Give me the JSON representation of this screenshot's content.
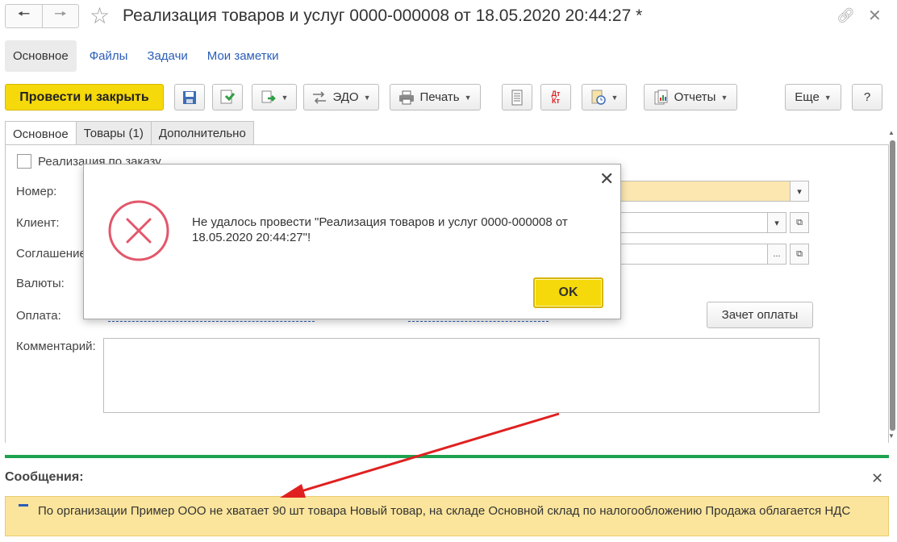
{
  "window": {
    "title": "Реализация товаров и услуг 0000-000008 от 18.05.2020 20:44:27 *",
    "back_icon": "arrow-left-icon",
    "forward_icon": "arrow-right-icon"
  },
  "topnav": {
    "items": [
      "Основное",
      "Файлы",
      "Задачи",
      "Мои заметки"
    ]
  },
  "toolbar": {
    "post_close": "Провести и закрыть",
    "edo": "ЭДО",
    "print": "Печать",
    "reports": "Отчеты",
    "more": "Еще",
    "help": "?"
  },
  "form_tabs": [
    "Основное",
    "Товары (1)",
    "Дополнительно"
  ],
  "form": {
    "by_order": "Реализация по заказу",
    "number": "Номер:",
    "client": "Клиент:",
    "agreement": "Соглашение",
    "currency": "Валюты:",
    "payment": "Оплата:",
    "comment": "Комментарий:",
    "offset_btn": "Зачет оплаты",
    "ellipsis": "..."
  },
  "dialog": {
    "message": "Не удалось провести \"Реализация товаров и услуг 0000-000008 от 18.05.2020 20:44:27\"!",
    "ok": "OK",
    "icon": "error-x-icon",
    "error_color": "#e2576b"
  },
  "messages": {
    "title": "Сообщения:",
    "text": "По организации Пример ООО не хватает 90 шт товара Новый товар, на складе Основной склад  по налогообложению Продажа облагается НДС"
  },
  "colors": {
    "accent_yellow": "#f5d90a",
    "link_blue": "#2b5db8",
    "green": "#1ca24e",
    "message_bg": "#fbe59c",
    "arrow_red": "#e02020"
  }
}
